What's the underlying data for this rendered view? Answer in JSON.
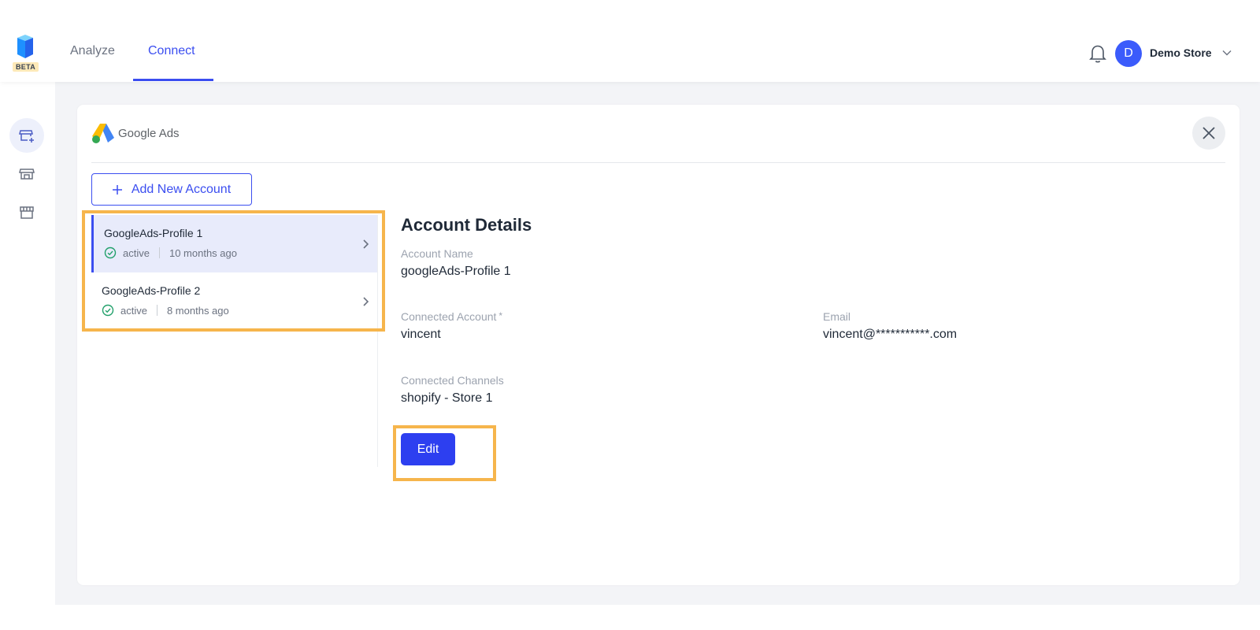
{
  "topbar": {
    "logo_badge": "BETA",
    "tabs": [
      {
        "label": "Analyze"
      },
      {
        "label": "Connect"
      }
    ],
    "avatar_initial": "D",
    "store_name": "Demo Store"
  },
  "card": {
    "integration_name": "Google Ads",
    "add_button_label": "Add New Account",
    "accounts": [
      {
        "name": "GoogleAds-Profile 1",
        "status": "active",
        "time": "10 months ago"
      },
      {
        "name": "GoogleAds-Profile 2",
        "status": "active",
        "time": "8 months ago"
      }
    ],
    "details": {
      "title": "Account Details",
      "account_name_label": "Account Name",
      "account_name_value": "googleAds-Profile 1",
      "connected_account_label": "Connected Account",
      "connected_account_required": "*",
      "connected_account_value": "vincent",
      "email_label": "Email",
      "email_value": "vincent@***********.com",
      "channels_label": "Connected Channels",
      "channels_value": "shopify - Store 1"
    },
    "edit_button_label": "Edit"
  },
  "colors": {
    "accent": "#3b4ef0",
    "highlight": "#f6b54c",
    "status_ok": "#22a06b"
  },
  "icons": {
    "logo": "app-logo-icon",
    "bell": "bell-icon",
    "chevron_down": "chevron-down-icon",
    "close": "close-icon",
    "plus": "plus-icon",
    "check_circle": "check-circle-icon",
    "chevron_right": "chevron-right-icon"
  }
}
